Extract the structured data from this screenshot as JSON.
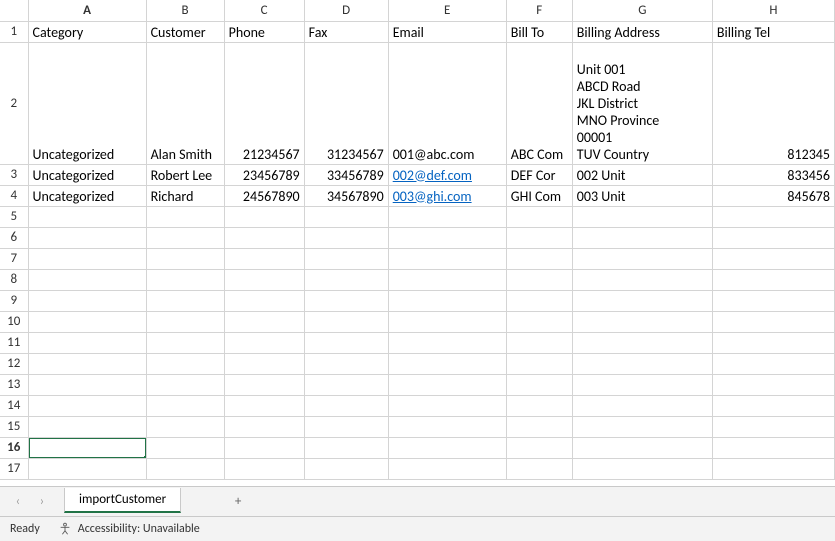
{
  "columns": [
    "A",
    "B",
    "C",
    "D",
    "E",
    "F",
    "G",
    "H"
  ],
  "rowCount": 17,
  "headers": {
    "A": "Category",
    "B": "Customer",
    "C": "Phone",
    "D": "Fax",
    "E": "Email",
    "F": "Bill To",
    "G": "Billing Address",
    "H": "Billing Tel"
  },
  "rows": [
    {
      "category": "Uncategorized",
      "customer": "Alan Smith",
      "phone": "21234567",
      "fax": "31234567",
      "email": "001@abc.com",
      "email_link": false,
      "billto": "ABC Com",
      "billing_address": "\nUnit 001\nABCD Road\nJKL District\nMNO Province\n00001\nTUV Country",
      "billing_tel": "812345"
    },
    {
      "category": "Uncategorized",
      "customer": "Robert Lee",
      "phone": "23456789",
      "fax": "33456789",
      "email": "002@def.com",
      "email_link": true,
      "billto": "DEF Cor",
      "billing_address": "002 Unit",
      "billing_tel": "833456"
    },
    {
      "category": "Uncategorized",
      "customer": "Richard",
      "phone": "24567890",
      "fax": "34567890",
      "email": "003@ghi.com",
      "email_link": true,
      "billto": "GHI Com",
      "billing_address": "003 Unit",
      "billing_tel": "845678"
    }
  ],
  "selected_cell": "A16",
  "tabs": {
    "active": "importCustomer"
  },
  "status": {
    "ready": "Ready",
    "accessibility": "Accessibility: Unavailable"
  },
  "icons": {
    "prev": "‹",
    "next": "›",
    "add": "+"
  }
}
